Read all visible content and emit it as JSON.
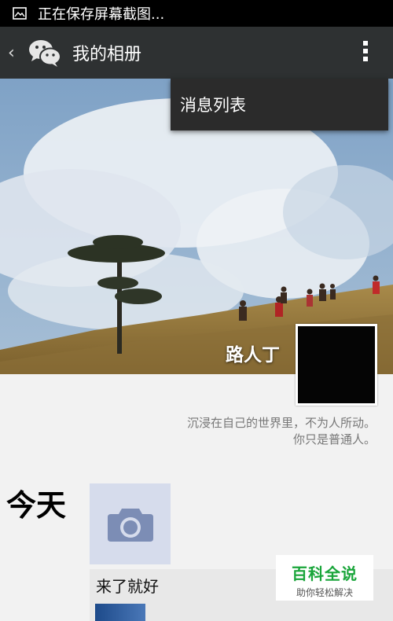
{
  "status_bar": {
    "text": "正在保存屏幕截图...",
    "icon": "image-icon"
  },
  "action_bar": {
    "back_icon": "chevron-left-icon",
    "logo_icon": "wechat-icon",
    "title": "我的相册",
    "more_icon": "more-vertical-icon"
  },
  "dropdown_menu": {
    "items": [
      {
        "label": "消息列表"
      }
    ]
  },
  "profile": {
    "name": "路人丁",
    "signature_line1": "沉浸在自己的世界里，不为人所动。",
    "signature_line2": "你只是普通人。"
  },
  "timeline": {
    "day_label": "今天",
    "camera_icon": "camera-icon",
    "post_text": "来了就好"
  },
  "watermark": {
    "title": "百科全说",
    "subtitle": "助你轻松解决"
  }
}
